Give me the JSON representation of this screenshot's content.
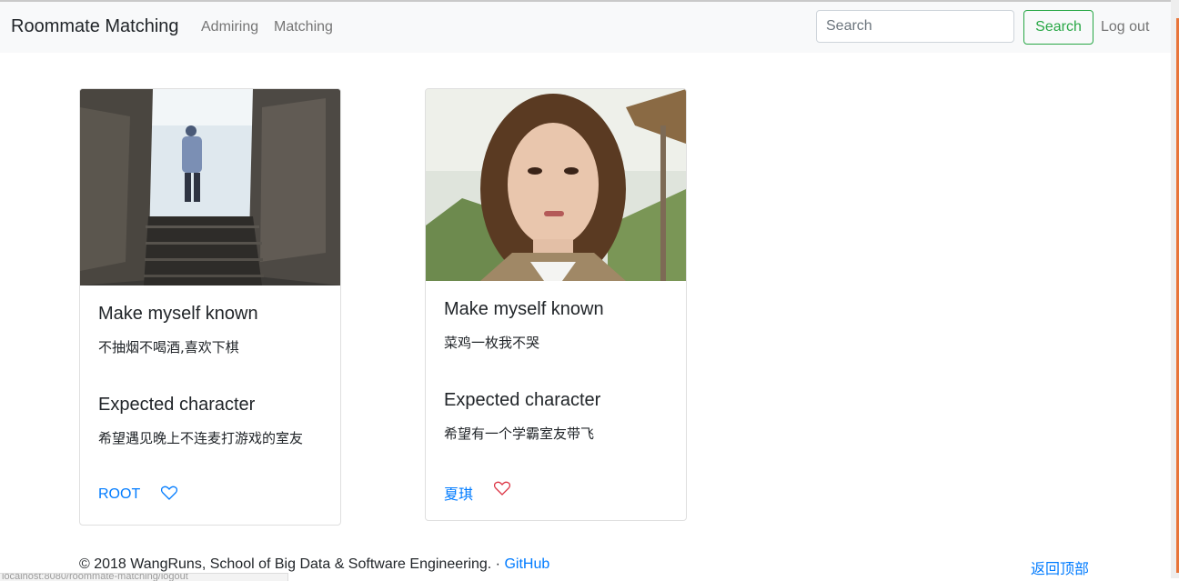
{
  "navbar": {
    "brand": "Roommate Matching",
    "links": [
      "Admiring",
      "Matching"
    ],
    "search_placeholder": "Search",
    "search_button": "Search",
    "logout": "Log out"
  },
  "cards": [
    {
      "image": "person-walking-up-stone-stairs-photo",
      "section1_title": "Make myself known",
      "section1_text": "不抽烟不喝酒,喜欢下棋",
      "section2_title": "Expected character",
      "section2_text": "希望遇见晚上不连麦打游戏的室友",
      "name": "ROOT",
      "icon": "heart-outline-icon",
      "icon_color": "#007bff"
    },
    {
      "image": "woman-portrait-photo",
      "section1_title": "Make myself known",
      "section1_text": "菜鸡一枚我不哭",
      "section2_title": "Expected character",
      "section2_text": "希望有一个学霸室友带飞",
      "name": "夏琪",
      "icon": "heart-outline-icon",
      "icon_color": "#dc3545"
    }
  ],
  "footer": {
    "copyright": "© 2018 WangRuns, School of Big Data & Software Engineering. · ",
    "github": "GitHub",
    "back_to_top": "返回顶部"
  },
  "status_bar": "localhost:8080/roommate-matching/logout"
}
